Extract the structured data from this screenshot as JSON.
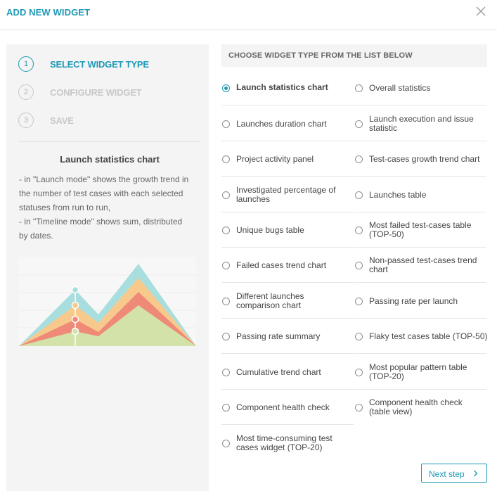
{
  "header": {
    "title": "ADD NEW WIDGET"
  },
  "steps": [
    {
      "number": "1",
      "label": "SELECT WIDGET TYPE",
      "active": true
    },
    {
      "number": "2",
      "label": "CONFIGURE WIDGET",
      "active": false
    },
    {
      "number": "3",
      "label": "SAVE",
      "active": false
    }
  ],
  "preview": {
    "title": "Launch statistics chart",
    "description_lines": [
      "- in \"Launch mode\" shows the growth trend in",
      "the number of test cases with each selected",
      "statuses from run to run,",
      "- in \"Timeline mode\" shows sum, distributed",
      "by dates."
    ]
  },
  "list_header": "CHOOSE WIDGET TYPE FROM THE LIST BELOW",
  "options": [
    {
      "label": "Launch statistics chart",
      "checked": true
    },
    {
      "label": "Overall statistics",
      "checked": false
    },
    {
      "label": "Launches duration chart",
      "checked": false
    },
    {
      "label": "Launch execution and issue statistic",
      "checked": false
    },
    {
      "label": "Project activity panel",
      "checked": false
    },
    {
      "label": "Test-cases growth trend chart",
      "checked": false
    },
    {
      "label": "Investigated percentage of launches",
      "checked": false
    },
    {
      "label": "Launches table",
      "checked": false
    },
    {
      "label": "Unique bugs table",
      "checked": false
    },
    {
      "label": "Most failed test-cases table (TOP-50)",
      "checked": false
    },
    {
      "label": "Failed cases trend chart",
      "checked": false
    },
    {
      "label": "Non-passed test-cases trend chart",
      "checked": false
    },
    {
      "label": "Different launches comparison chart",
      "checked": false
    },
    {
      "label": "Passing rate per launch",
      "checked": false
    },
    {
      "label": "Passing rate summary",
      "checked": false
    },
    {
      "label": "Flaky test cases table (TOP-50)",
      "checked": false
    },
    {
      "label": "Cumulative trend chart",
      "checked": false
    },
    {
      "label": "Most popular pattern table (TOP-20)",
      "checked": false
    },
    {
      "label": "Component health check",
      "checked": false
    },
    {
      "label": "Component health check (table view)",
      "checked": false
    },
    {
      "label": "Most time-consuming test cases widget (TOP-20)",
      "checked": false
    }
  ],
  "next_button": {
    "label": "Next step",
    "icon": "chevron-right-icon"
  },
  "colors": {
    "accent": "#1e99b6",
    "chart_layers": [
      "#a9dedf",
      "#f8c98c",
      "#ef8978",
      "#d2e2a8"
    ]
  }
}
